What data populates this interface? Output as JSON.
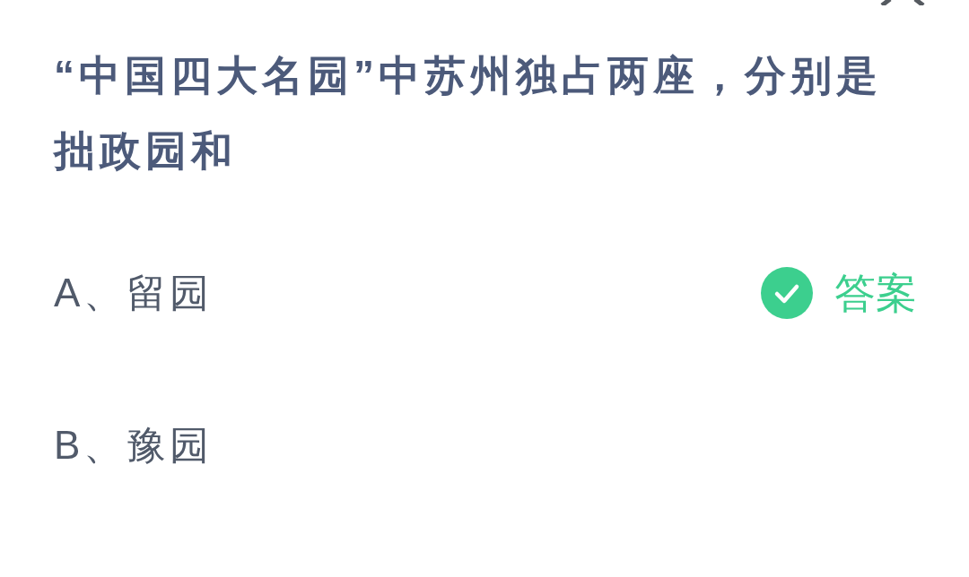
{
  "question": {
    "text": "“中国四大名园”中苏州独占两座，分别是拙政园和"
  },
  "options": [
    {
      "label": "A、留园",
      "correct": true,
      "tag": "答案"
    },
    {
      "label": "B、豫园",
      "correct": false
    }
  ]
}
